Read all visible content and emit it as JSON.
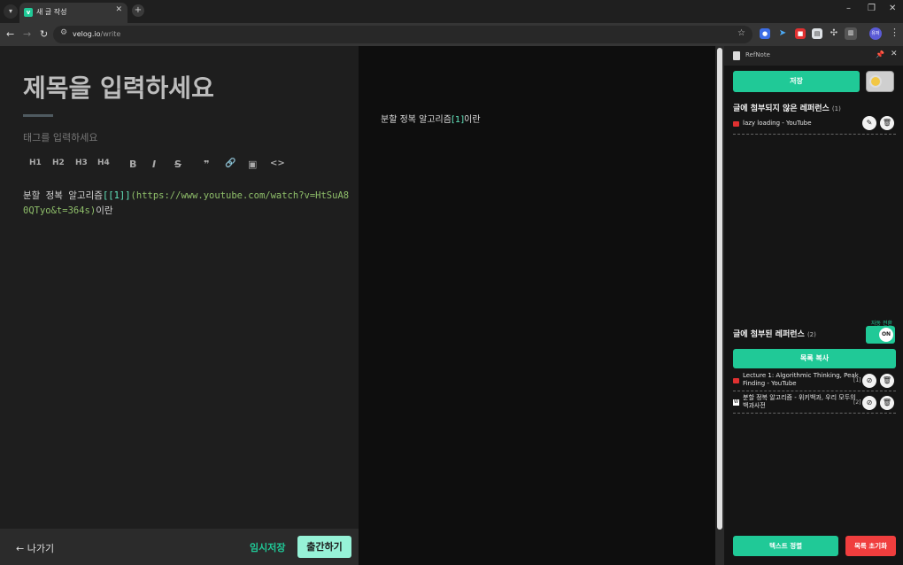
{
  "browser": {
    "tab_title": "새 글 작성",
    "favicon_letter": "v",
    "url_host": "velog.io",
    "url_path": "/write",
    "avatar_label": "유저"
  },
  "editor": {
    "title_placeholder": "제목을 입력하세요",
    "tags_placeholder": "태그를 입력하세요",
    "toolbar": [
      "H1",
      "H2",
      "H3",
      "H4",
      "B",
      "I",
      "S",
      "❞",
      "🔗",
      "▣",
      "<>"
    ],
    "body_prefix": "분할 정복 알고리즘",
    "body_ref": "[[1]]",
    "body_link": "(https://www.youtube.com/watch?v=HtSuA80QTyo&t=364s)",
    "body_suffix": "이란",
    "exit_label": "나가기",
    "save_draft_label": "임시저장",
    "publish_label": "출간하기"
  },
  "preview": {
    "text_prefix": "분할 정복 알고리즘",
    "text_ref": "[1]",
    "text_suffix": "이란"
  },
  "panel": {
    "name": "RefNote",
    "save_label": "저장",
    "unattached_title": "글에 첨부되지 않은 레퍼런스",
    "unattached_count": "(1)",
    "unattached_items": [
      {
        "title": "lazy loading - YouTube",
        "source": "youtube"
      }
    ],
    "attached_title": "글에 첨부된 레퍼런스",
    "attached_count": "(2)",
    "auto_label": "자동 전환",
    "toggle_label": "ON",
    "copy_list_label": "목록 복사",
    "attached_items": [
      {
        "title_line1": "Lecture 1: Algorithmic Thinking, Peak",
        "title_line2": "Finding - YouTube",
        "index": "[1]",
        "source": "youtube"
      },
      {
        "title_line1": "분할 정복 알고리즘 - 위키백과, 우리 모두의",
        "title_line2": "백과사전",
        "index": "[2]",
        "source": "wikipedia"
      }
    ],
    "sort_text_label": "텍스트 정렬",
    "reset_list_label": "목록 초기화"
  },
  "colors": {
    "accent": "#20c997",
    "danger": "#f03e3e",
    "publish_bg": "#96f2d7"
  }
}
